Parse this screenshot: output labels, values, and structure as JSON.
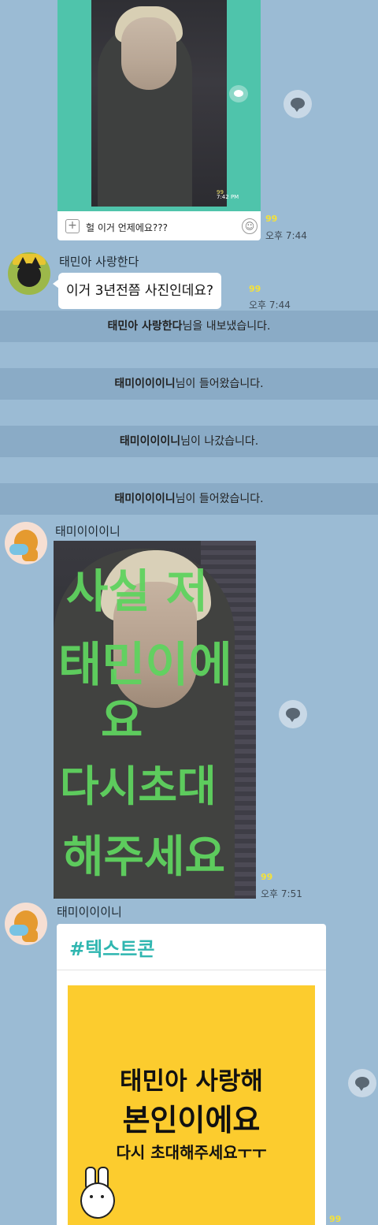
{
  "messages": {
    "m1": {
      "image_time": "7:42 PM",
      "image_unread": "99",
      "reply_text": "헐 이거 언제에요???",
      "unread": "99",
      "time": "오후 7:44"
    },
    "m2": {
      "sender": "태민아 사랑한다",
      "text": "이거 3년전쯤 사진인데요?",
      "unread": "99",
      "time": "오후 7:44"
    },
    "m3": {
      "sender": "태미이이이니",
      "unread": "99",
      "time": "오후 7:51"
    },
    "m4": {
      "sender": "태미이이이니",
      "card_tag": "#텍스트콘",
      "line1": "태민아 사랑해",
      "line2": "본인이에요",
      "line3": "다시 초대해주세요ㅜㅜ",
      "unread": "99"
    }
  },
  "system": [
    {
      "name": "태민아 사랑한다",
      "suffix": "님을 내보냈습니다."
    },
    {
      "name": "태미이이이니",
      "suffix": "님이 들어왔습니다."
    },
    {
      "name": "태미이이이니",
      "suffix": "님이 나갔습니다."
    },
    {
      "name": "태미이이이니",
      "suffix": "님이 들어왔습니다."
    }
  ],
  "handwriting": [
    "사실 저",
    "태민이에",
    "요",
    "다시초대",
    "해주세요"
  ],
  "colors": {
    "background": "#9bbbd4",
    "system_band": "#8aabc6",
    "unread": "#f4e13a",
    "textcon_tag": "#2fb6b0",
    "textcon_bg": "#fccc2e"
  }
}
